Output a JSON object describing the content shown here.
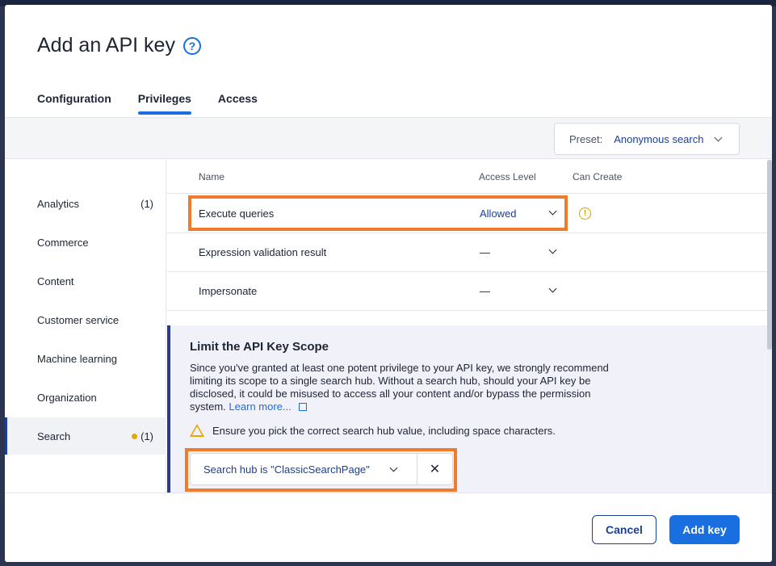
{
  "modal": {
    "title": "Add an API key",
    "help_icon": "?"
  },
  "tabs": [
    {
      "label": "Configuration",
      "active": false
    },
    {
      "label": "Privileges",
      "active": true
    },
    {
      "label": "Access",
      "active": false
    }
  ],
  "preset": {
    "label": "Preset:",
    "value": "Anonymous search"
  },
  "sidebar": {
    "items": [
      {
        "label": "Analytics",
        "count": "(1)"
      },
      {
        "label": "Commerce",
        "count": ""
      },
      {
        "label": "Content",
        "count": ""
      },
      {
        "label": "Customer service",
        "count": ""
      },
      {
        "label": "Machine learning",
        "count": ""
      },
      {
        "label": "Organization",
        "count": ""
      },
      {
        "label": "Search",
        "count": "(1)",
        "active": true
      }
    ]
  },
  "table": {
    "headers": {
      "name": "Name",
      "access_level": "Access Level",
      "can_create": "Can Create"
    },
    "rows": [
      {
        "name": "Execute queries",
        "level": "Allowed"
      },
      {
        "name": "Expression validation result",
        "level": "—"
      },
      {
        "name": "Impersonate",
        "level": "—"
      }
    ],
    "warning_icon": "!"
  },
  "scope": {
    "title": "Limit the API Key Scope",
    "text": "Since you've granted at least one potent privilege to your API key, we strongly recommend limiting its scope to a single search hub. Without a search hub, should your API key be disclosed, it could be misused to access all your content and/or bypass the permission system.",
    "learn_more": "Learn more...",
    "warning": "Ensure you pick the correct search hub value, including space characters.",
    "hub_value": "Search hub is \"ClassicSearchPage\"",
    "clear_icon": "✕"
  },
  "footer": {
    "cancel_label": "Cancel",
    "add_label": "Add key"
  },
  "colors": {
    "accent": "#1a6fe0",
    "highlight": "#f07b2a",
    "navy": "#1b3f93",
    "warning": "#e0a800"
  }
}
